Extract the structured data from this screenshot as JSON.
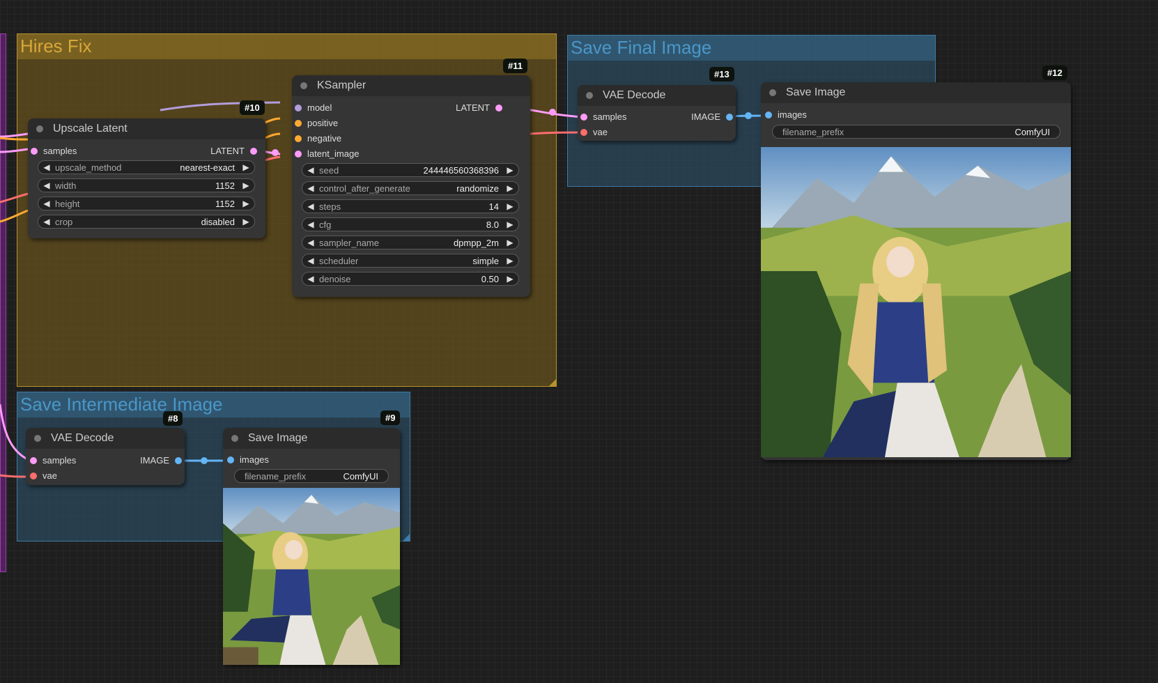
{
  "groups": {
    "hires_fix": {
      "title": "Hires Fix"
    },
    "save_final": {
      "title": "Save Final Image"
    },
    "save_intermediate": {
      "title": "Save Intermediate Image"
    }
  },
  "nodes": {
    "upscale_latent": {
      "id": "#10",
      "title": "Upscale Latent",
      "input_samples": "samples",
      "output_latent": "LATENT",
      "widgets": [
        {
          "label": "upscale_method",
          "value": "nearest-exact"
        },
        {
          "label": "width",
          "value": "1152"
        },
        {
          "label": "height",
          "value": "1152"
        },
        {
          "label": "crop",
          "value": "disabled"
        }
      ]
    },
    "ksampler": {
      "id": "#11",
      "title": "KSampler",
      "inputs": [
        "model",
        "positive",
        "negative",
        "latent_image"
      ],
      "output_latent": "LATENT",
      "widgets": [
        {
          "label": "seed",
          "value": "244446560368396"
        },
        {
          "label": "control_after_generate",
          "value": "randomize"
        },
        {
          "label": "steps",
          "value": "14"
        },
        {
          "label": "cfg",
          "value": "8.0"
        },
        {
          "label": "sampler_name",
          "value": "dpmpp_2m"
        },
        {
          "label": "scheduler",
          "value": "simple"
        },
        {
          "label": "denoise",
          "value": "0.50"
        }
      ]
    },
    "vae_decode_final": {
      "id": "#13",
      "title": "VAE Decode",
      "inputs": [
        "samples",
        "vae"
      ],
      "output_image": "IMAGE"
    },
    "save_image_final": {
      "id": "#12",
      "title": "Save Image",
      "input_images": "images",
      "filename_label": "filename_prefix",
      "filename_value": "ComfyUI"
    },
    "vae_decode_intermediate": {
      "id": "#8",
      "title": "VAE Decode",
      "inputs": [
        "samples",
        "vae"
      ],
      "output_image": "IMAGE"
    },
    "save_image_intermediate": {
      "id": "#9",
      "title": "Save Image",
      "input_images": "images",
      "filename_label": "filename_prefix",
      "filename_value": "ComfyUI"
    }
  },
  "colors": {
    "canvas": "#1e1e1e",
    "hires_group": "#6e5a1e",
    "save_group": "#2c4f66",
    "latent_wire": "#ff9cf9",
    "image_wire": "#64b5f6",
    "vae_wire": "#ff6e6e",
    "conditioning_wire": "#ffa931",
    "model_wire": "#b39ddb"
  }
}
